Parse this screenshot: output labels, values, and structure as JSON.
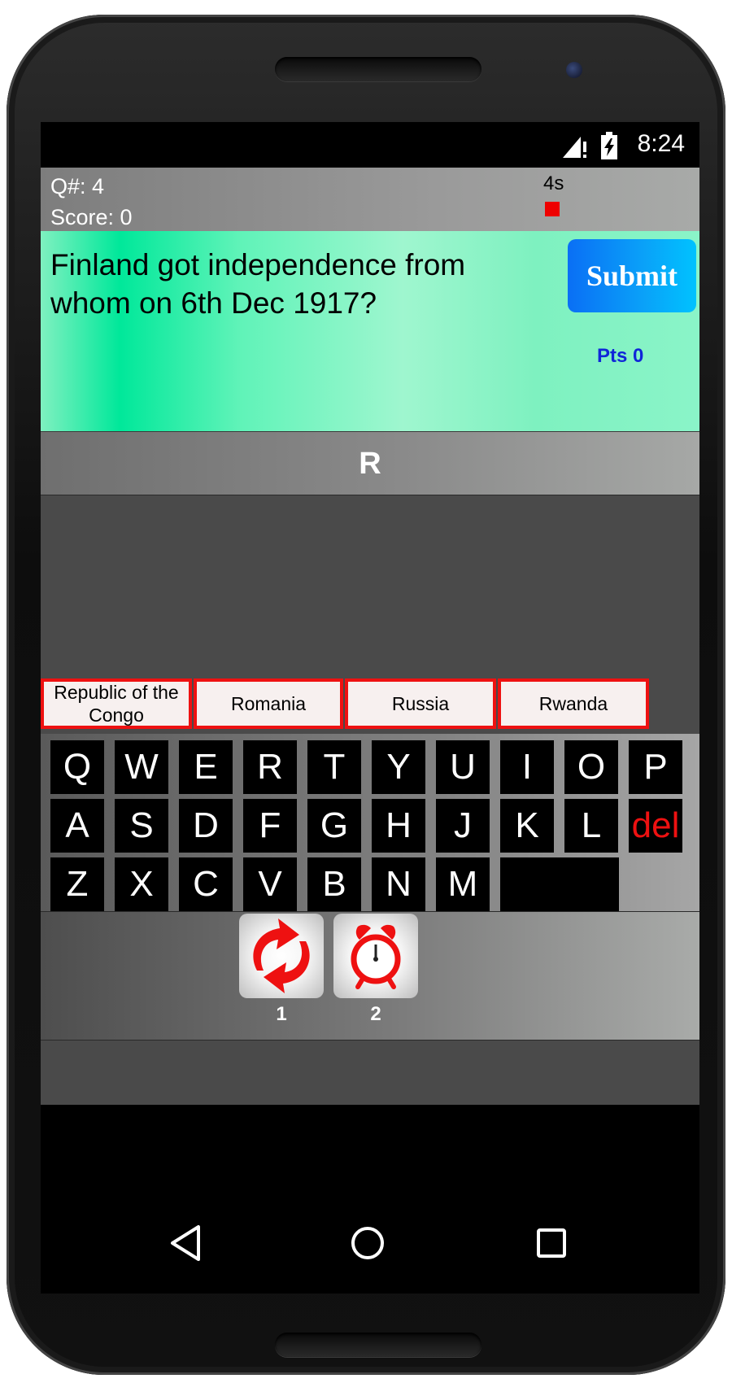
{
  "status_bar": {
    "time": "8:24",
    "icons": [
      "signal-icon",
      "battery-charging-icon"
    ]
  },
  "header": {
    "question_number": "Q#: 4",
    "score": "Score: 0",
    "timer": "4s",
    "timer_color": "#ee0000"
  },
  "question": {
    "text": "Finland got independence from whom on 6th Dec 1917?",
    "submit_label": "Submit",
    "points": "Pts 0"
  },
  "answer": {
    "current": "R"
  },
  "options": [
    {
      "label": "Republic of the Congo"
    },
    {
      "label": "Romania"
    },
    {
      "label": "Russia"
    },
    {
      "label": "Rwanda"
    }
  ],
  "keyboard": {
    "row1": [
      "Q",
      "W",
      "E",
      "R",
      "T",
      "Y",
      "U",
      "I",
      "O",
      "P"
    ],
    "row2": [
      "A",
      "S",
      "D",
      "F",
      "G",
      "H",
      "J",
      "K",
      "L"
    ],
    "row3": [
      "Z",
      "X",
      "C",
      "V",
      "B",
      "N",
      "M"
    ],
    "del_label": "del"
  },
  "powerups": [
    {
      "icon": "refresh-arrows-icon",
      "count": "1"
    },
    {
      "icon": "alarm-clock-icon",
      "count": "2"
    }
  ],
  "navbar": {
    "icons": [
      "back-icon",
      "home-icon",
      "recents-icon"
    ]
  },
  "colors": {
    "accent_red": "#ee1111",
    "submit_blue": "#0a8ff6",
    "question_green": "#00e89a"
  }
}
